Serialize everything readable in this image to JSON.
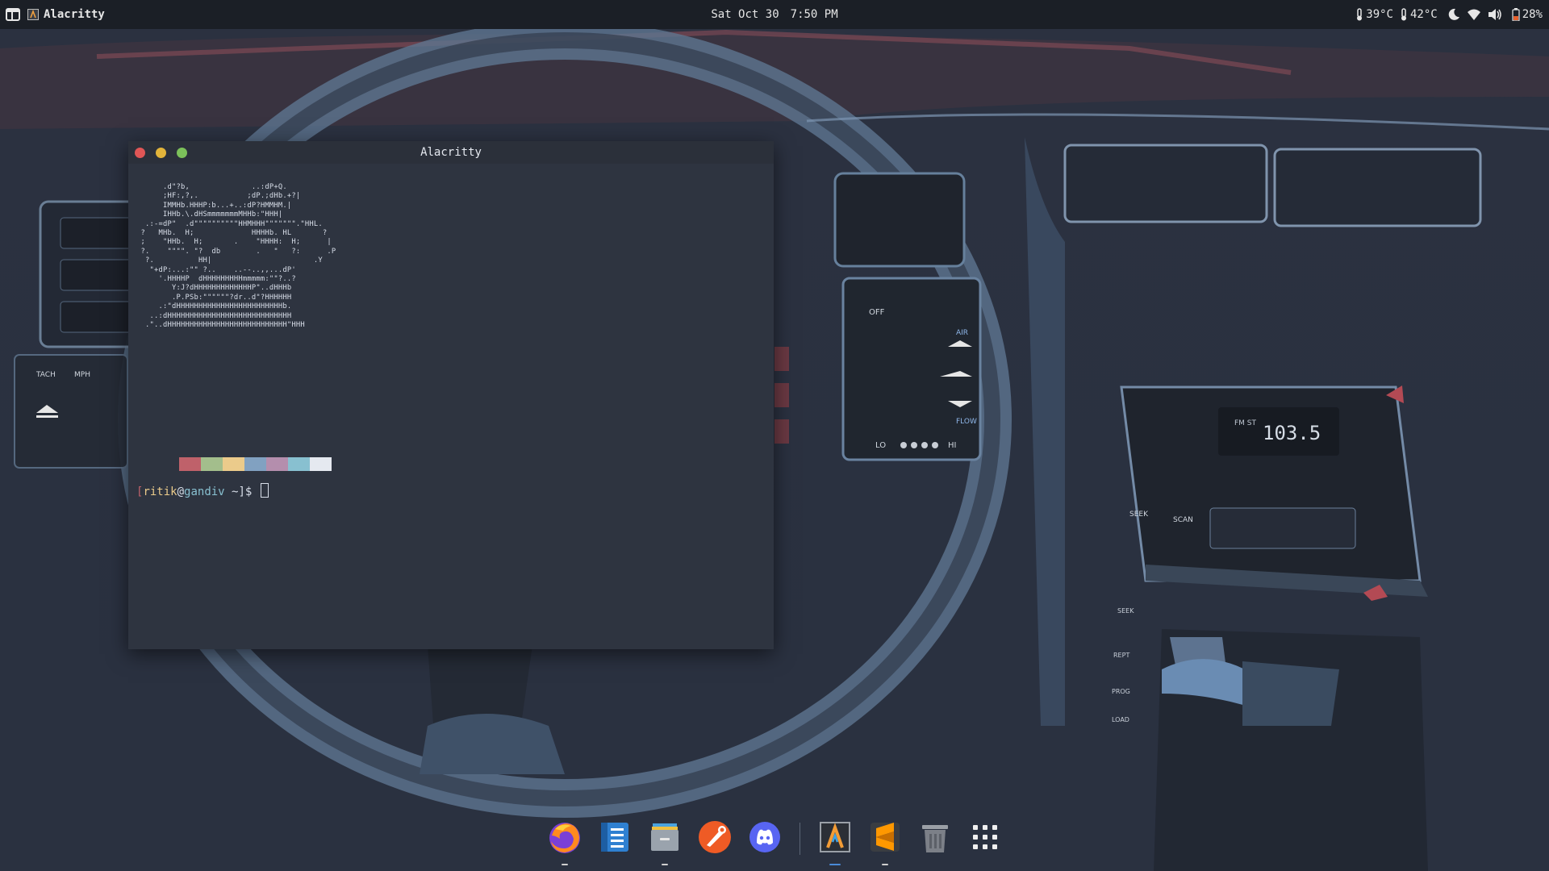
{
  "topbar": {
    "activities_icon": "window-grid-icon",
    "active_app_icon": "alacritty-icon",
    "active_app": "Alacritty",
    "date": "Sat Oct 30",
    "time": "7:50 PM",
    "temp_cpu": "39°C",
    "temp_gpu": "42°C",
    "battery": "28%",
    "icons": [
      "thermometer-icon",
      "thermometer-icon",
      "night-light-icon",
      "wifi-icon",
      "volume-icon",
      "battery-icon"
    ]
  },
  "terminal": {
    "title": "Alacritty",
    "ascii_art": "      .d\"?b,              ..:dP+Q.\n      ;HF:,?,.           ;dP.;dHb.+?|\n      IMMHb.HHHP:b...+..:dP?HMMHM.|\n      IHHb.\\.dHSmmmmmmmMHHb:\"HHH|\n  .:-=dP\"  .d\"\"\"\"\"\"\"\"\"\"HHMHHH\"\"\"\"\"\"\".\"HHL.\n ?   MHb.  H;             HHHHb. HL       ?\n ;    \"HHb.  H;       .    \"HHHH:  H;      |\n ?.    \"\"\"\". \"?  db        .   \"   ?:      .P\n  ?.          HH|                       .Y\n   \"+dP:...:\"\" ?..    ..--..,,...dP'\n     '.HHHHP  dHHHHHHHHHmmmmm:\"\"?..?\n        Y:J?dHHHHHHHHHHHHHP\"..dHHHb\n        .P.PSb:\"\"\"\"\"\"?dr..d\"?HHHHHH\n     .:\"dHHHHHHHHHHHHHHHHHHHHHHHHb.\n   ..:dHHHHHHHHHHHHHHHHHHHHHHHHHHHH\n  .\"..dHHHHHHHHHHHHHHHHHHHHHHHHHHH\"HHH",
    "prompt_user": "ritik",
    "prompt_at": "@",
    "prompt_host": "gandiv",
    "prompt_path": "~",
    "prompt_open": "[",
    "prompt_close": "]$",
    "palette": [
      "#2e3440",
      "#bf616a",
      "#a3be8c",
      "#ebcb8b",
      "#81a1c1",
      "#b48ead",
      "#88c0d0",
      "#e5e9f0"
    ]
  },
  "dock": {
    "items": [
      {
        "name": "firefox",
        "icon": "firefox-icon",
        "running": true
      },
      {
        "name": "text-editor",
        "icon": "notes-icon",
        "running": false
      },
      {
        "name": "files",
        "icon": "file-cabinet-icon",
        "running": true
      },
      {
        "name": "postman",
        "icon": "postman-icon",
        "running": false
      },
      {
        "name": "discord",
        "icon": "discord-icon",
        "running": false
      },
      {
        "name": "alacritty",
        "icon": "alacritty-icon",
        "running": true,
        "active": true
      },
      {
        "name": "sublime-text",
        "icon": "sublime-icon",
        "running": true
      },
      {
        "name": "trash",
        "icon": "trash-icon",
        "running": false
      },
      {
        "name": "show-apps",
        "icon": "app-grid-icon",
        "running": false
      }
    ]
  },
  "colors": {
    "panel_bg": "#1b1f26",
    "terminal_bg": "#2e3440",
    "titlebar_bg": "#2b303a",
    "close": "#e05656",
    "minimize": "#e2b43a",
    "maximize": "#7cc15a",
    "prompt_bracket": "#bf616a",
    "prompt_user": "#ebcb8b",
    "prompt_host": "#88c0d0",
    "dock_active": "#4a8bd8"
  }
}
